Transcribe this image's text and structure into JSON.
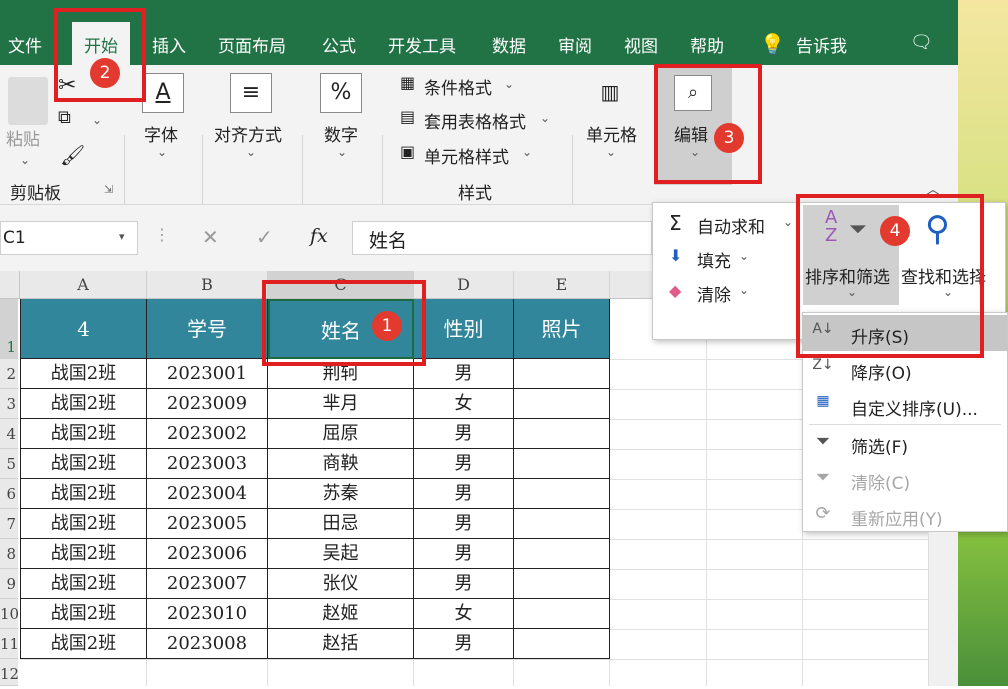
{
  "tabs": [
    "文件",
    "开始",
    "插入",
    "页面布局",
    "公式",
    "开发工具",
    "数据",
    "审阅",
    "视图",
    "帮助"
  ],
  "tell_me": "告诉我",
  "ribbon": {
    "paste": "粘贴",
    "clipboard": "剪贴板",
    "font": "字体",
    "align": "对齐方式",
    "number": "数字",
    "cond_format": "条件格式",
    "table_format": "套用表格格式",
    "cell_style": "单元格样式",
    "styles": "样式",
    "cells": "单元格",
    "edit": "编辑"
  },
  "formula_bar": {
    "namebox": "C1",
    "fx": "fx",
    "content": "姓名"
  },
  "columns": [
    "A",
    "B",
    "C",
    "D",
    "E"
  ],
  "rows": [
    "1",
    "2",
    "3",
    "4",
    "5",
    "6",
    "7",
    "8",
    "9",
    "10",
    "11",
    "12"
  ],
  "table": {
    "header": [
      "4",
      "学号",
      "姓名",
      "性别",
      "照片"
    ],
    "data": [
      [
        "战国2班",
        "2023001",
        "荆轲",
        "男"
      ],
      [
        "战国2班",
        "2023009",
        "芈月",
        "女"
      ],
      [
        "战国2班",
        "2023002",
        "屈原",
        "男"
      ],
      [
        "战国2班",
        "2023003",
        "商鞅",
        "男"
      ],
      [
        "战国2班",
        "2023004",
        "苏秦",
        "男"
      ],
      [
        "战国2班",
        "2023005",
        "田忌",
        "男"
      ],
      [
        "战国2班",
        "2023006",
        "吴起",
        "男"
      ],
      [
        "战国2班",
        "2023007",
        "张仪",
        "男"
      ],
      [
        "战国2班",
        "2023010",
        "赵姬",
        "女"
      ],
      [
        "战国2班",
        "2023008",
        "赵括",
        "男"
      ]
    ]
  },
  "edit_menu": {
    "autosum": "自动求和",
    "fill": "填充",
    "clear": "清除",
    "sort_filter": "排序和筛选",
    "find_select": "查找和选择"
  },
  "sort_menu": {
    "asc": "升序(S)",
    "desc": "降序(O)",
    "custom": "自定义排序(U)...",
    "filter": "筛选(F)",
    "clear": "清除(C)",
    "reapply": "重新应用(Y)"
  },
  "badges": [
    "1",
    "2",
    "3",
    "4"
  ],
  "colors": {
    "excel_green": "#217346",
    "header_teal": "#31869b",
    "highlight": "#e02020"
  }
}
